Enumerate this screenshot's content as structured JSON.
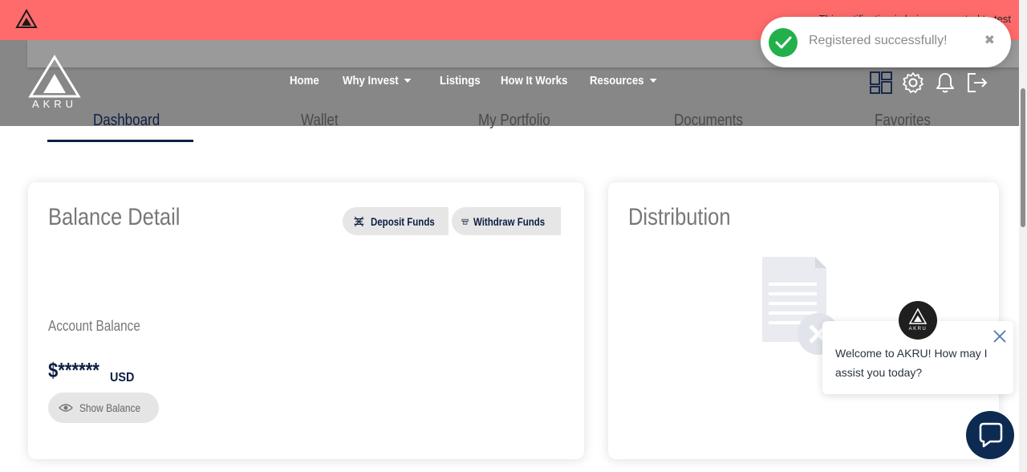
{
  "banner": {
    "text": "This notification is being presented to test",
    "logo_text": "AKRU"
  },
  "header": {
    "logo_text": "AKRU",
    "nav": [
      {
        "label": "Home"
      },
      {
        "label": "Why Invest"
      },
      {
        "label": "Listings"
      },
      {
        "label": "How It Works"
      },
      {
        "label": "Resources"
      }
    ],
    "icons": [
      "dashboard-grid-icon",
      "settings-gear-icon",
      "notification-bell-icon",
      "logout-icon"
    ]
  },
  "tabs": [
    {
      "label": "Dashboard",
      "active": true
    },
    {
      "label": "Wallet"
    },
    {
      "label": "My Portfolio"
    },
    {
      "label": "Documents"
    },
    {
      "label": "Favorites"
    }
  ],
  "balance": {
    "title": "Balance Detail",
    "deposit_label": "Deposit Funds",
    "withdraw_label": "Withdraw Funds",
    "account_label": "Account Balance",
    "amount": "$******",
    "currency": "USD",
    "show_label": "Show Balance"
  },
  "distribution": {
    "title": "Distribution"
  },
  "toast": {
    "message": "Registered successfully!",
    "close": "✖"
  },
  "chat": {
    "message": "Welcome to AKRU! How may I assist you today?",
    "avatar_text": "AKRU"
  },
  "colors": {
    "banner": "#ff6b6b",
    "navy": "#0d1f44",
    "success": "#22b04b"
  }
}
